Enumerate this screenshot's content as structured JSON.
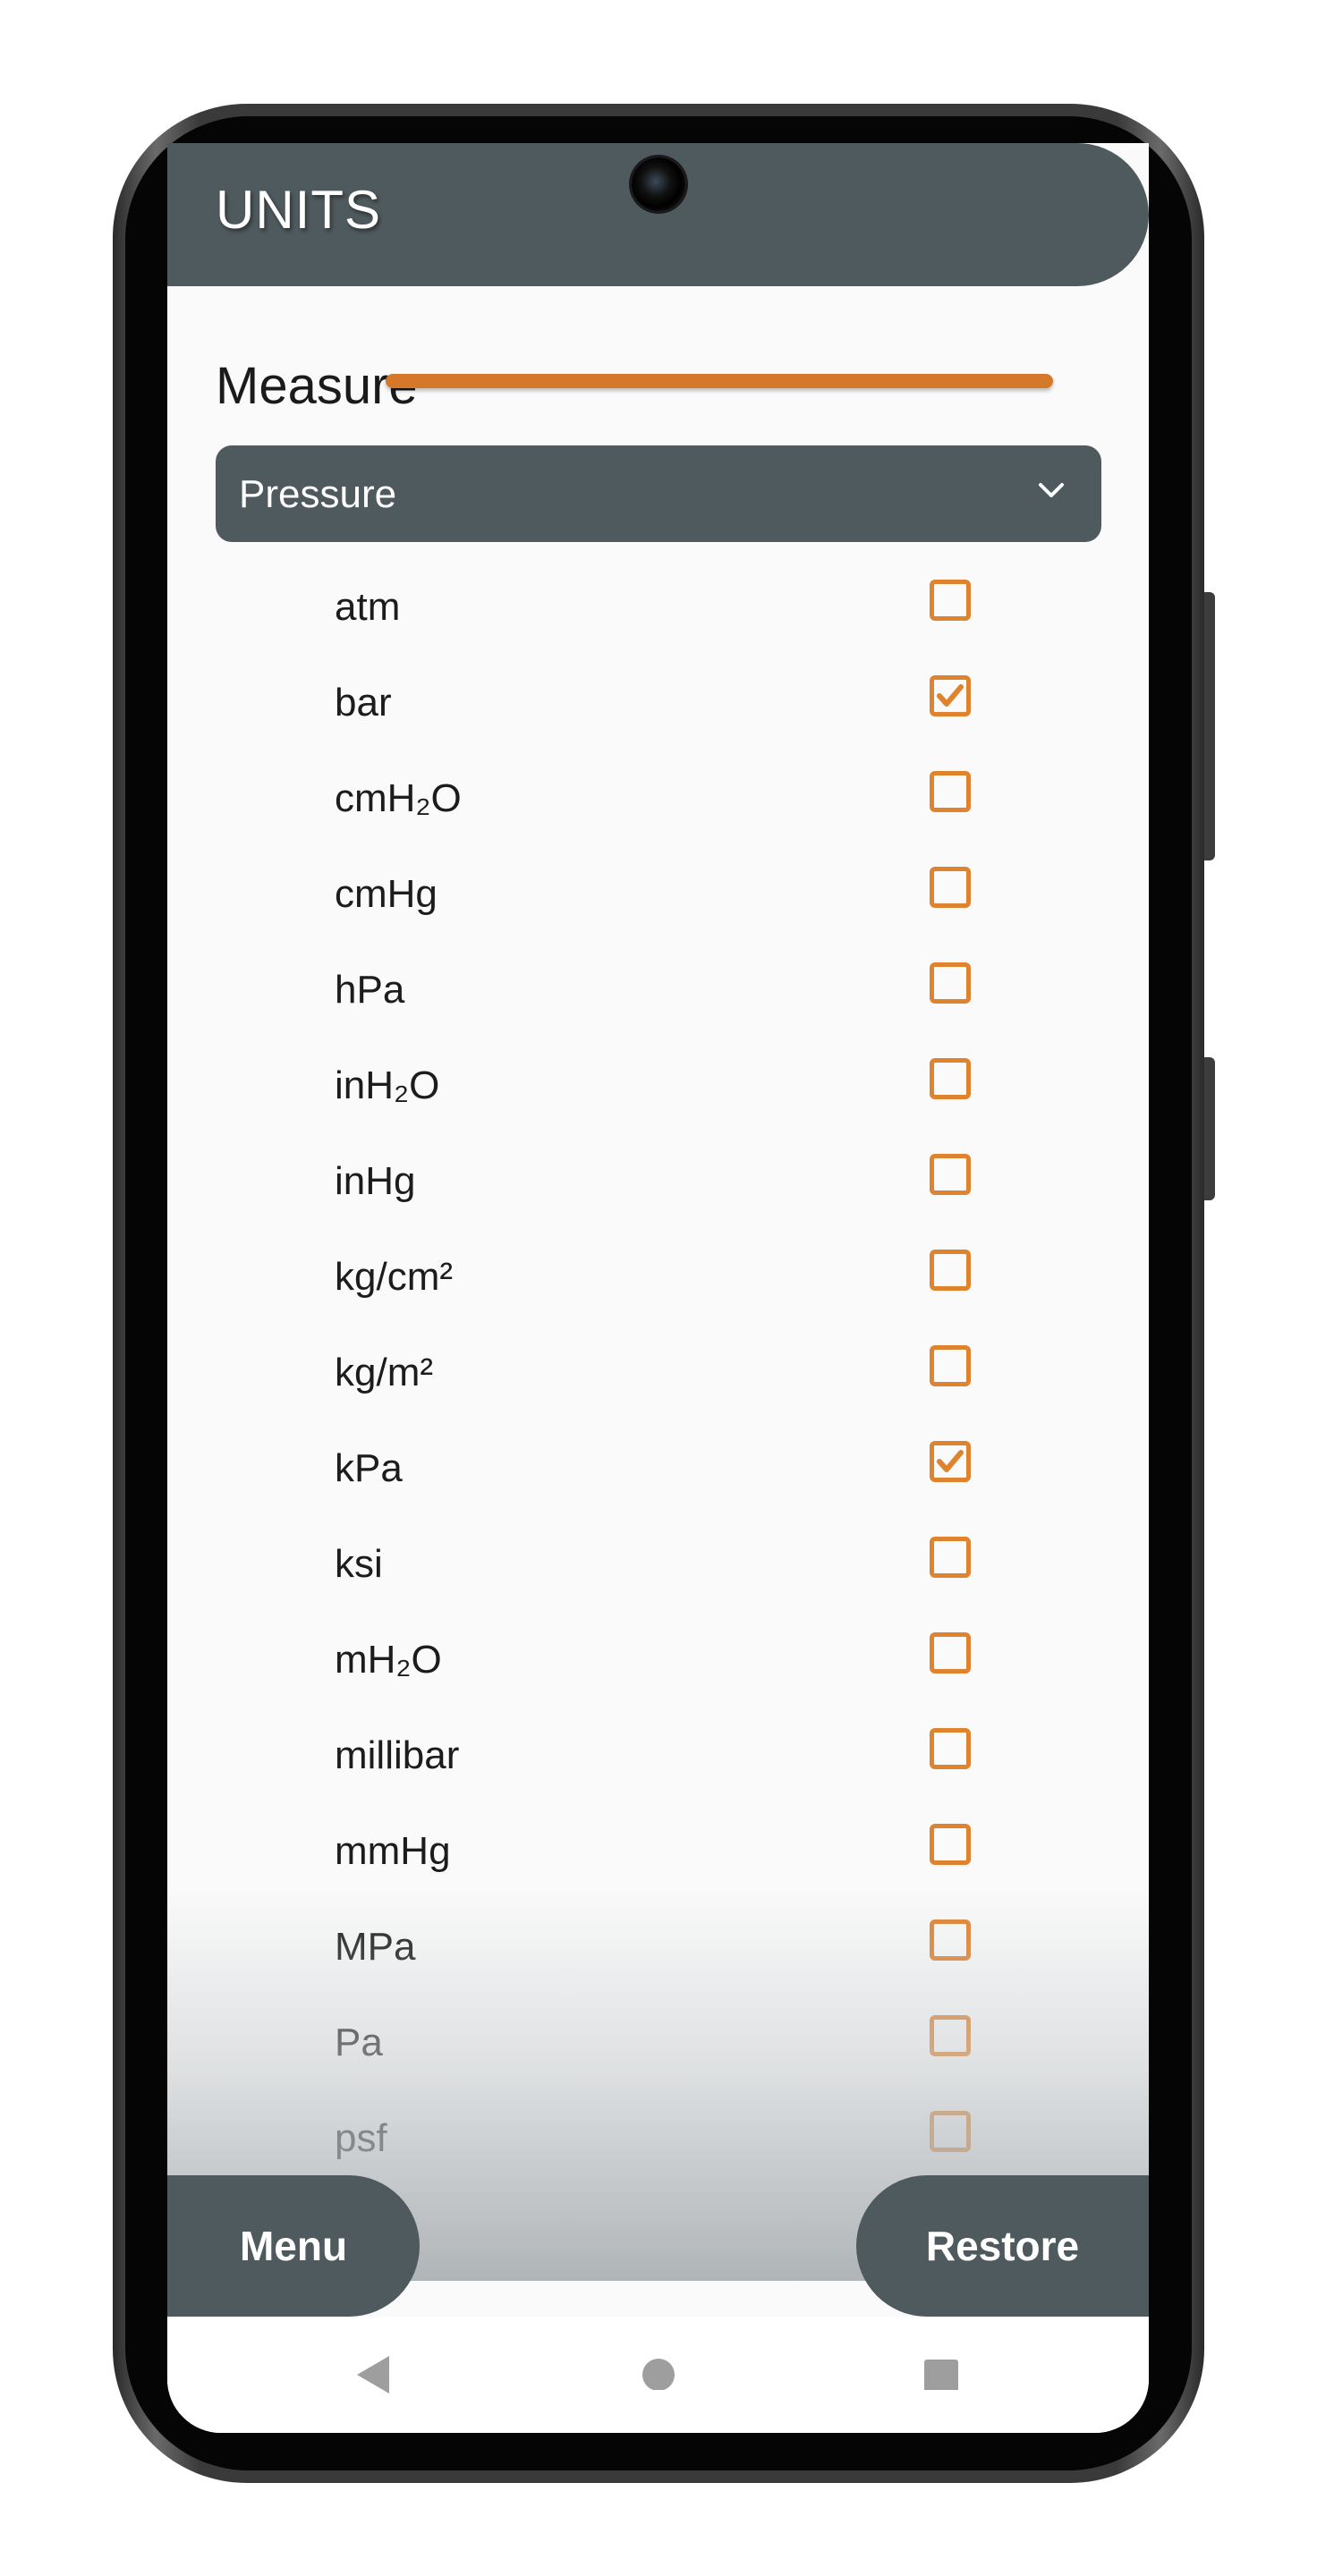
{
  "appbar": {
    "title": "UNITS"
  },
  "measure": {
    "label": "Measure",
    "selected": "Pressure"
  },
  "units": [
    {
      "label": "atm",
      "checked": false
    },
    {
      "label": "bar",
      "checked": true
    },
    {
      "label": "cmH₂O",
      "checked": false
    },
    {
      "label": "cmHg",
      "checked": false
    },
    {
      "label": "hPa",
      "checked": false
    },
    {
      "label": "inH₂O",
      "checked": false
    },
    {
      "label": "inHg",
      "checked": false
    },
    {
      "label": "kg/cm²",
      "checked": false
    },
    {
      "label": "kg/m²",
      "checked": false
    },
    {
      "label": "kPa",
      "checked": true
    },
    {
      "label": "ksi",
      "checked": false
    },
    {
      "label": "mH₂O",
      "checked": false
    },
    {
      "label": "millibar",
      "checked": false
    },
    {
      "label": "mmHg",
      "checked": false
    },
    {
      "label": "MPa",
      "checked": false
    },
    {
      "label": "Pa",
      "checked": false
    },
    {
      "label": "psf",
      "checked": false
    }
  ],
  "buttons": {
    "menu": "Menu",
    "restore": "Restore"
  },
  "colors": {
    "accent": "#e0832f",
    "surface": "#4f5a5e",
    "background": "#fafafa"
  },
  "icons": {
    "dropdown": "chevron-down-icon",
    "check": "check-icon",
    "nav_back": "back-triangle-icon",
    "nav_home": "home-circle-icon",
    "nav_recents": "recents-square-icon"
  }
}
